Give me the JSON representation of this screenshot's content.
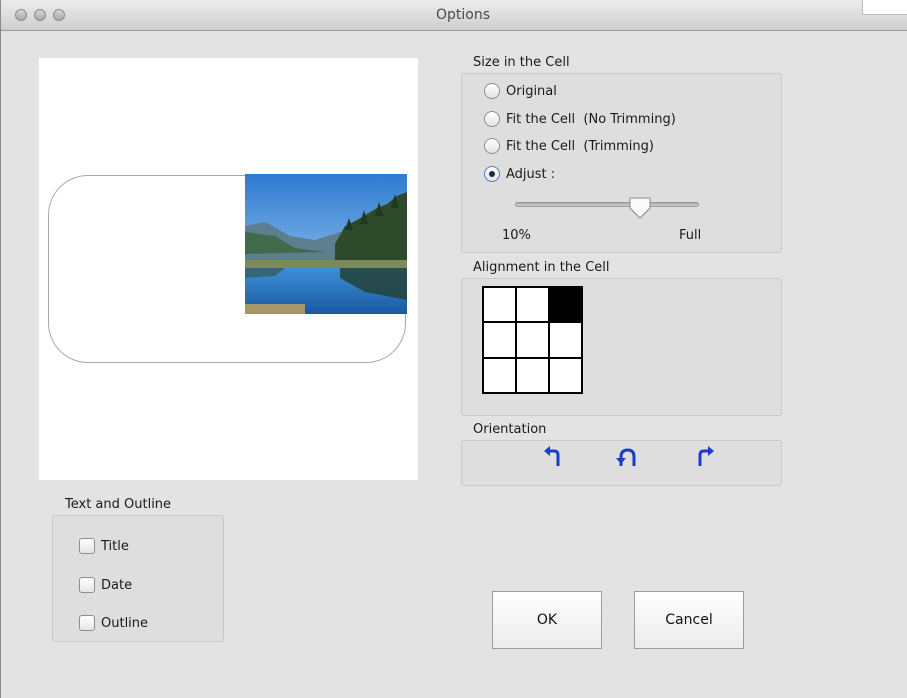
{
  "window": {
    "title": "Options"
  },
  "size_group": {
    "label": "Size in the Cell",
    "options": [
      {
        "label": "Original",
        "selected": false
      },
      {
        "label": "Fit the Cell  (No Trimming)",
        "selected": false
      },
      {
        "label": "Fit the Cell  (Trimming)",
        "selected": false
      },
      {
        "label": "Adjust :",
        "selected": true
      }
    ],
    "slider": {
      "min_label": "10%",
      "max_label": "Full",
      "value_fraction": 0.67
    }
  },
  "alignment_group": {
    "label": "Alignment in the Cell",
    "selected_cell": "top-right",
    "cells": [
      false,
      false,
      true,
      false,
      false,
      false,
      false,
      false,
      false
    ]
  },
  "orientation_group": {
    "label": "Orientation",
    "buttons": [
      "rotate-left-icon",
      "flip-icon",
      "rotate-right-icon"
    ]
  },
  "text_outline_group": {
    "label": "Text and Outline",
    "checkboxes": [
      {
        "label": "Title",
        "checked": false
      },
      {
        "label": "Date",
        "checked": false
      },
      {
        "label": "Outline",
        "checked": false
      }
    ]
  },
  "buttons": {
    "ok": "OK",
    "cancel": "Cancel"
  },
  "colors": {
    "accent_blue": "#1a3ccc",
    "window_bg": "#e3e3e3"
  }
}
